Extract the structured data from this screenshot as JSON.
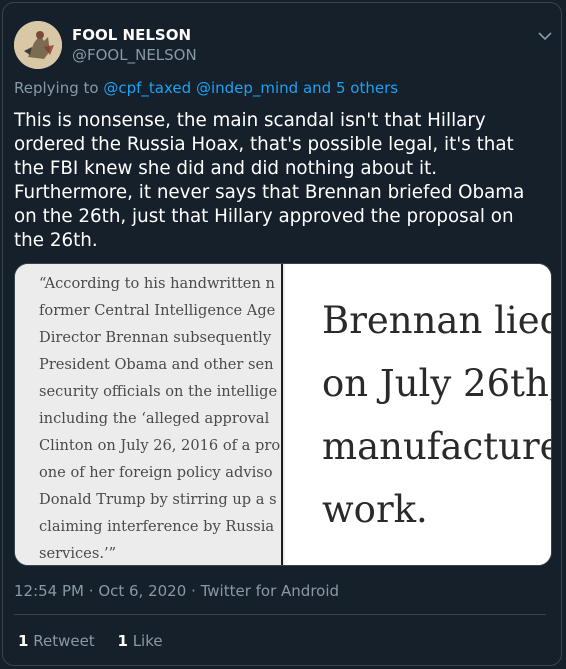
{
  "user": {
    "name": "FOOL NELSON",
    "handle": "@FOOL_NELSON"
  },
  "reply": {
    "prefix": "Replying to",
    "mention1": "@cpf_taxed",
    "mention2": "@indep_mind",
    "others": "and 5 others"
  },
  "tweet": {
    "text": "This is nonsense, the main scandal isn't that Hillary ordered the Russia Hoax, that's possible legal, it's that the FBI knew she did and did nothing about it. Furthermore, it never says that Brennan briefed Obama on the 26th, just that Hillary approved the proposal on the 26th."
  },
  "media": {
    "left_quote": "“According to his handwritten n\nformer Central Intelligence Age\nDirector Brennan subsequently\nPresident Obama and other sen\nsecurity officials on the intellige\nincluding the ‘alleged approval\nClinton on July 26, 2016 of a pro\none of her foreign policy adviso\nDonald Trump by stirring up a s\nclaiming interference by Russia\nservices.’”",
    "right_text": "Brennan lied\non July 26th,\nmanufacture\nwork."
  },
  "meta": {
    "time": "12:54 PM",
    "date": "Oct 6, 2020",
    "source": "Twitter for Android"
  },
  "stats": {
    "retweets_count": "1",
    "retweets_label": "Retweet",
    "likes_count": "1",
    "likes_label": "Like"
  }
}
